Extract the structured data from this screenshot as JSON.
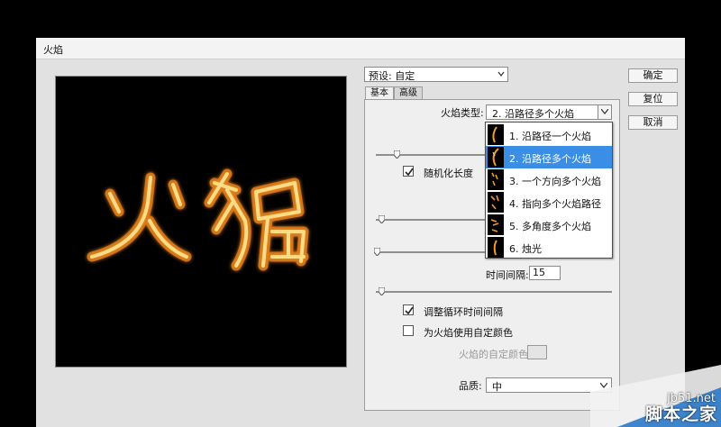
{
  "dialog": {
    "title": "火焰",
    "preset_label": "预设: 自定"
  },
  "buttons": {
    "ok": "确定",
    "reset": "复位",
    "cancel": "取消"
  },
  "tabs": [
    {
      "label": "基本",
      "active": true
    },
    {
      "label": "高级",
      "active": false
    }
  ],
  "basic": {
    "flame_type_label": "火焰类型:",
    "flame_type_value": "2. 沿路径多个火焰",
    "randomize_length_label": "随机化长度",
    "randomize_length_checked": true,
    "time_interval_label": "时间间隔:",
    "time_interval_value": "15",
    "adjust_loop_label": "调整循环时间间隔",
    "adjust_loop_checked": true,
    "custom_color_label": "为火焰使用自定颜色",
    "custom_color_checked": false,
    "flame_color_label": "火焰的自定颜色:",
    "quality_label": "品质:",
    "quality_value": "中"
  },
  "flame_type_options": [
    {
      "label": "1. 沿路径一个火焰",
      "selected": false
    },
    {
      "label": "2. 沿路径多个火焰",
      "selected": true
    },
    {
      "label": "3. 一个方向多个火焰",
      "selected": false
    },
    {
      "label": "4. 指向多个火焰路径",
      "selected": false
    },
    {
      "label": "5. 多角度多个火焰",
      "selected": false
    },
    {
      "label": "6. 烛光",
      "selected": false
    }
  ],
  "preview": {
    "text": "火焰"
  },
  "watermark": {
    "site": "jb51.net",
    "name": "脚本之家"
  },
  "colors": {
    "selection": "#3a8ee6",
    "flame_core": "#ffe28a",
    "flame_edge": "#e07a10"
  }
}
